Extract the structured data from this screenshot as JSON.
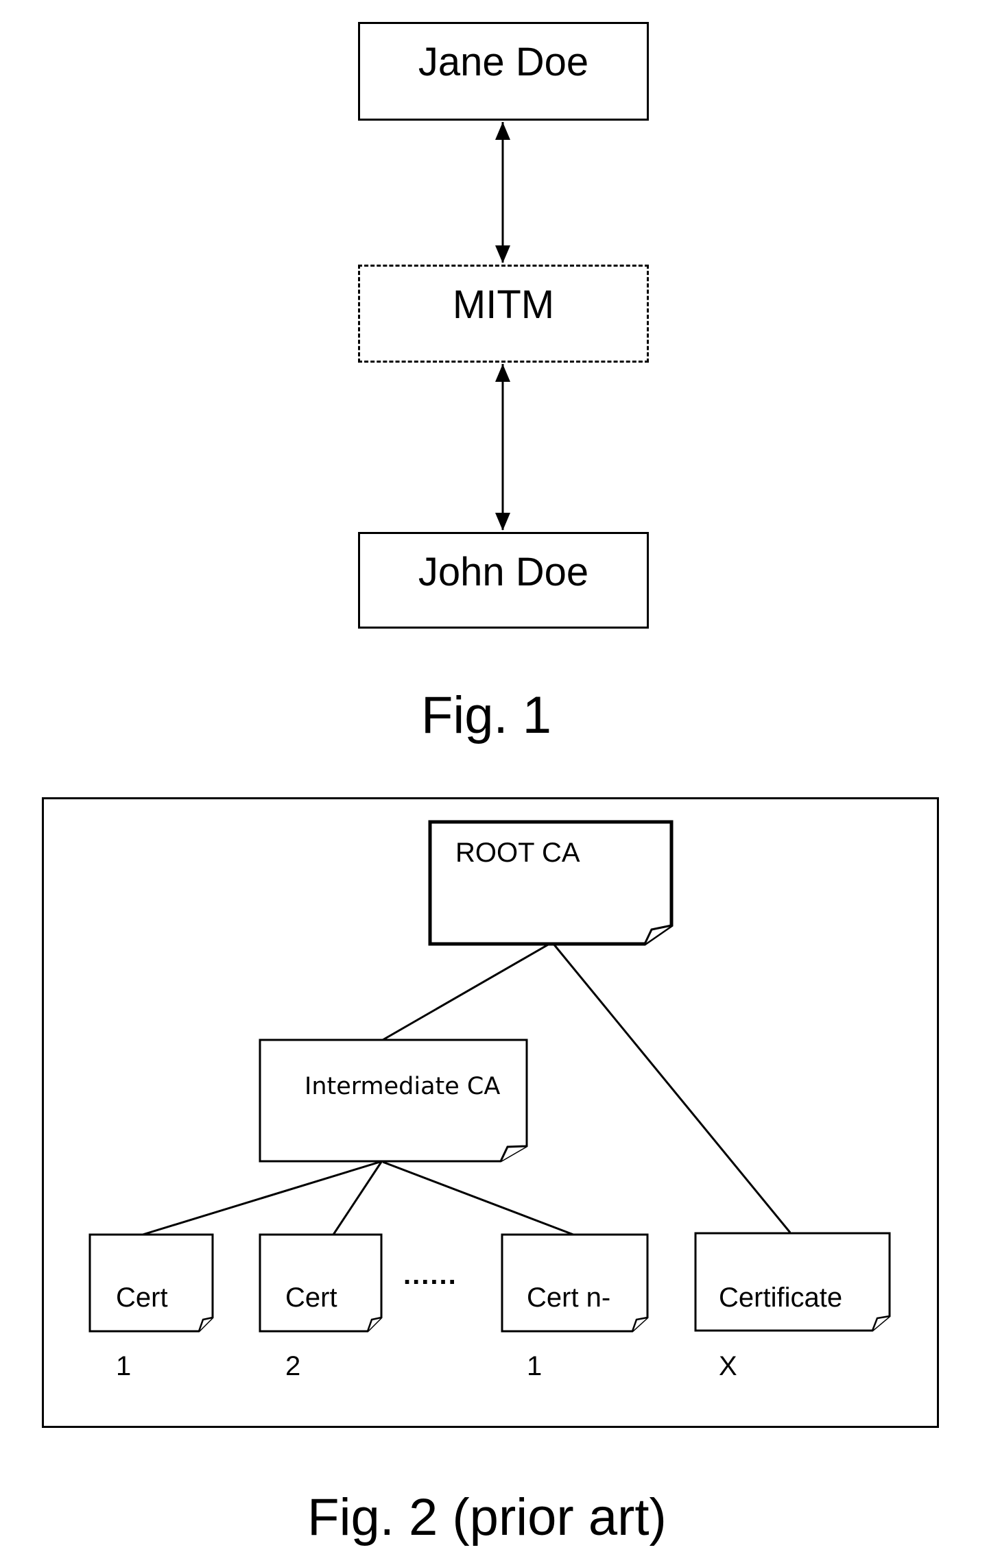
{
  "figure1": {
    "nodes": {
      "top": "Jane Doe",
      "middle": "MITM",
      "bottom": "John Doe"
    },
    "caption": "Fig. 1"
  },
  "figure2": {
    "root": "ROOT CA",
    "intermediate": "Intermediate CA",
    "leaves": [
      {
        "line1": "Cert",
        "line2": "1"
      },
      {
        "line1": "Cert",
        "line2": "2"
      },
      {
        "line1": "Cert n-",
        "line2": "1"
      },
      {
        "line1": "Certificate",
        "line2": "X"
      }
    ],
    "ellipsis": "......",
    "caption": "Fig. 2  (prior art)"
  }
}
